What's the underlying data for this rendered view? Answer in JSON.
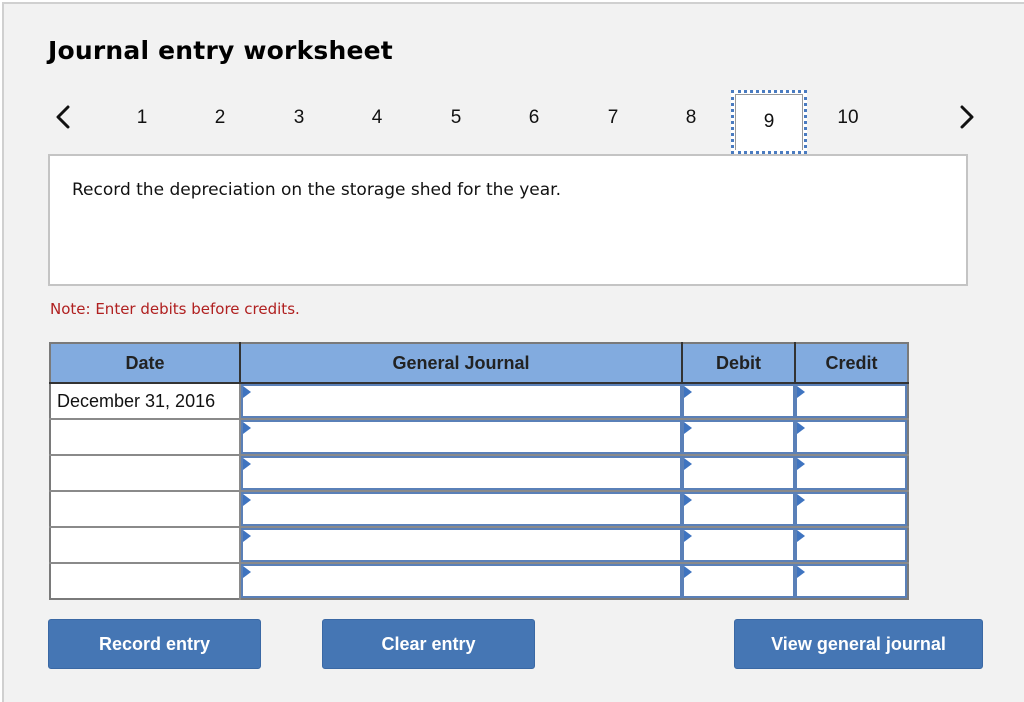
{
  "title": "Journal entry worksheet",
  "pagination": {
    "prev_icon": "chevron-left-icon",
    "next_icon": "chevron-right-icon",
    "pages": [
      "1",
      "2",
      "3",
      "4",
      "5",
      "6",
      "7",
      "8",
      "9",
      "10"
    ],
    "current_page": "9"
  },
  "prompt": "Record the depreciation on the storage shed for the year.",
  "note": "Note: Enter debits before credits.",
  "journal": {
    "columns": {
      "date": "Date",
      "general_journal": "General Journal",
      "debit": "Debit",
      "credit": "Credit"
    },
    "rows": [
      {
        "date": "December 31, 2016",
        "account": "",
        "debit": "",
        "credit": ""
      },
      {
        "date": "",
        "account": "",
        "debit": "",
        "credit": ""
      },
      {
        "date": "",
        "account": "",
        "debit": "",
        "credit": ""
      },
      {
        "date": "",
        "account": "",
        "debit": "",
        "credit": ""
      },
      {
        "date": "",
        "account": "",
        "debit": "",
        "credit": ""
      },
      {
        "date": "",
        "account": "",
        "debit": "",
        "credit": ""
      }
    ]
  },
  "buttons": {
    "record_entry": "Record entry",
    "clear_entry": "Clear entry",
    "view_general_journal": "View general journal"
  },
  "colors": {
    "accent": "#4576b4",
    "header_bg": "#82abdf",
    "note_text": "#b02020",
    "background": "#f2f2f2"
  }
}
